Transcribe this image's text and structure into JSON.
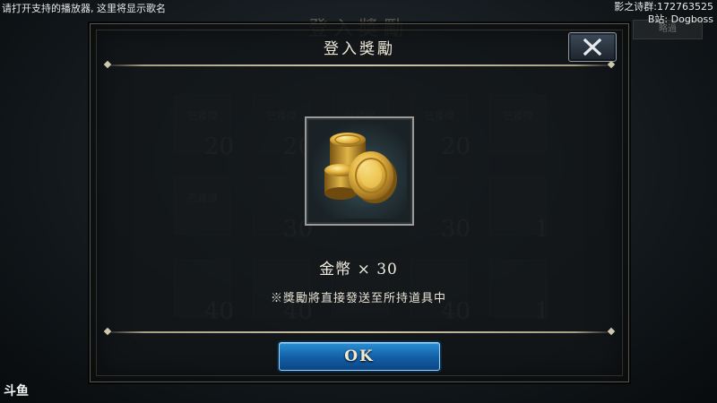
{
  "overlay": {
    "top_left": "请打开支持的播放器, 这里将显示歌名",
    "top_right_line1": "影之诗群:172763525",
    "top_right_line2": "B站: Dogboss",
    "logo": "斗鱼"
  },
  "background": {
    "title": "登入獎勵",
    "side_button": "略過",
    "claimed_label": "已獲得",
    "cells": [
      {
        "claimed": true,
        "num": "20"
      },
      {
        "claimed": true,
        "num": "20"
      },
      {
        "claimed": true,
        "num": ""
      },
      {
        "claimed": true,
        "num": "20"
      },
      {
        "claimed": true,
        "num": ""
      },
      {
        "claimed": true,
        "num": ""
      },
      {
        "claimed": false,
        "num": "30"
      },
      {
        "claimed": false,
        "num": ""
      },
      {
        "claimed": false,
        "num": "30"
      },
      {
        "claimed": false,
        "num": "1"
      },
      {
        "claimed": false,
        "num": "40"
      },
      {
        "claimed": false,
        "num": "40"
      },
      {
        "claimed": false,
        "num": ""
      },
      {
        "claimed": false,
        "num": "40"
      },
      {
        "claimed": false,
        "num": "1"
      }
    ]
  },
  "dialog": {
    "title": "登入獎勵",
    "reward_name": "金幣",
    "reward_quantity": "× 30",
    "note": "※獎勵將直接發送至所持道具中",
    "ok_label": "OK",
    "item_icon": "gold-coins-icon",
    "close_icon": "close-icon"
  },
  "colors": {
    "accent_blue": "#1462a8",
    "gold": "#c9a23a",
    "frame_border": "#5a5648"
  }
}
